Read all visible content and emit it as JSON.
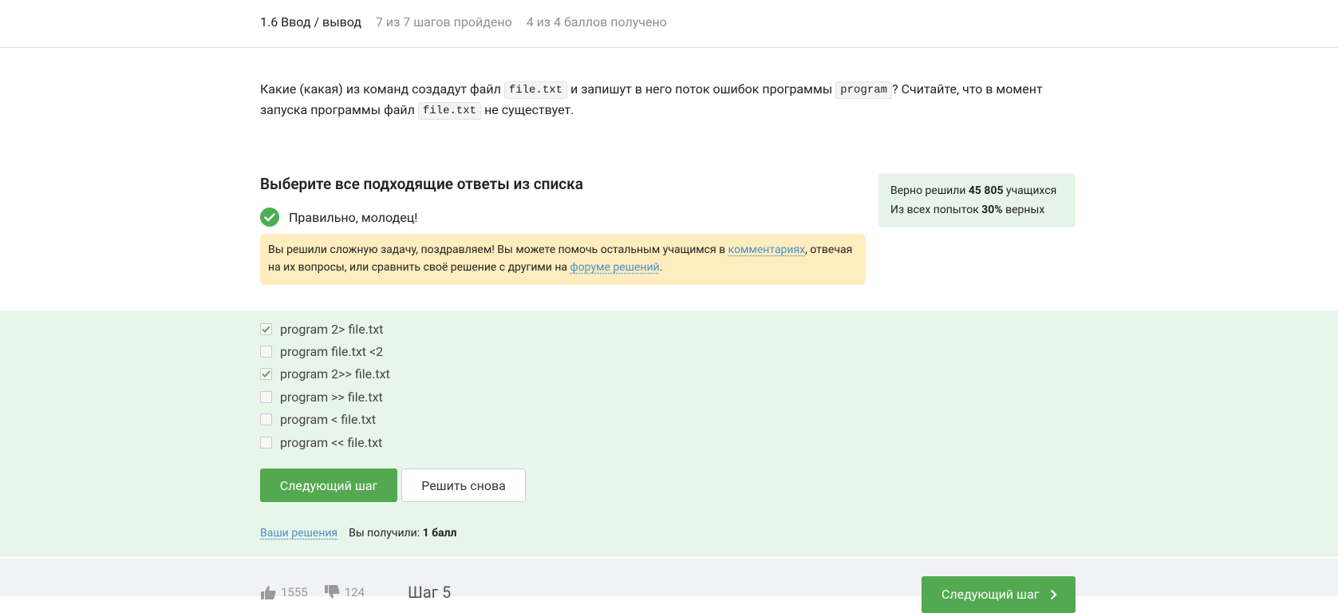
{
  "header": {
    "title": "1.6 Ввод / вывод",
    "steps_passed": "7 из 7 шагов пройдено",
    "points": "4 из 4 баллов  получено"
  },
  "question": {
    "part1": "Какие (какая) из команд создадут файл ",
    "code1": "file.txt",
    "part2": " и запишут в него поток ошибок программы ",
    "code2": "program",
    "part3": "? Считайте, что в момент запуска программы файл ",
    "code3": "file.txt",
    "part4": " не существует."
  },
  "prompt": "Выберите все подходящие ответы из списка",
  "feedback": "Правильно, молодец!",
  "hint": {
    "part1": "Вы решили сложную задачу, поздравляем! Вы можете помочь остальным учащимся в ",
    "comments_link": "комментариях",
    "part2": ", отвечая на их вопросы, или сравнить своё решение с другими на ",
    "forum_link": "форуме решений",
    "part3": "."
  },
  "stats": {
    "solved_prefix": "Верно решили ",
    "solved_count": "45 805",
    "solved_suffix": " учащихся",
    "attempts_prefix": "Из всех попыток ",
    "attempts_percent": "30%",
    "attempts_suffix": " верных"
  },
  "options": [
    {
      "label": "program 2> file.txt",
      "checked": true
    },
    {
      "label": "program file.txt <2",
      "checked": false
    },
    {
      "label": "program 2>> file.txt",
      "checked": true
    },
    {
      "label": "program >> file.txt",
      "checked": false
    },
    {
      "label": "program < file.txt",
      "checked": false
    },
    {
      "label": "program << file.txt",
      "checked": false
    }
  ],
  "buttons": {
    "next_step": "Следующий шаг",
    "solve_again": "Решить снова"
  },
  "result": {
    "your_solutions": "Ваши решения",
    "received_prefix": "Вы получили: ",
    "received_value": "1 балл"
  },
  "bottom_bar": {
    "likes": "1555",
    "dislikes": "124",
    "step_label": "Шаг 5",
    "next_button": "Следующий шаг"
  },
  "colors": {
    "accent_green": "#53a94f",
    "answer_zone_bg": "#e8f6ea",
    "hint_bg": "#ffedbf",
    "link": "#4a90c9"
  }
}
